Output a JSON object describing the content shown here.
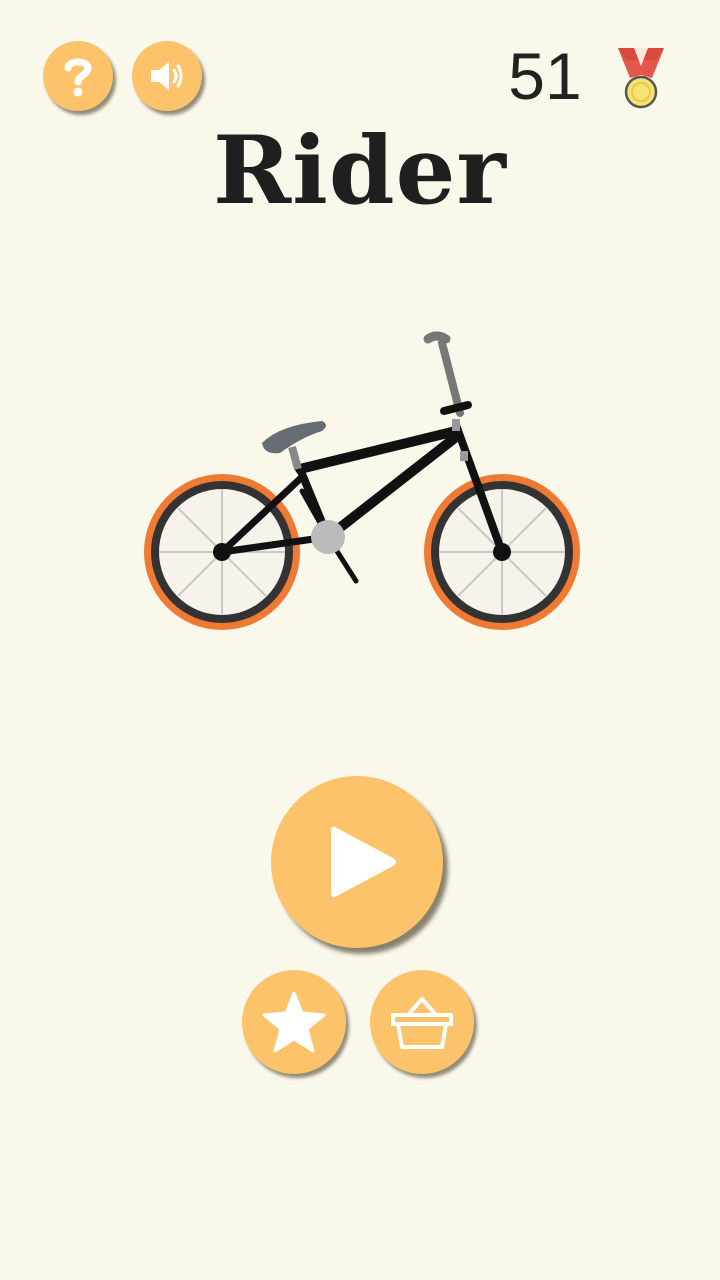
{
  "app": {
    "title": "Rider",
    "score": "51"
  },
  "icons": {
    "help": "question-mark-icon",
    "sound": "speaker-icon",
    "medal": "medal-icon",
    "play": "play-icon",
    "star": "star-icon",
    "shop": "basket-icon"
  },
  "colors": {
    "background": "#f9f8ea",
    "button": "#fcc36b",
    "tire_outer": "#f07a33",
    "frame": "#111111"
  }
}
